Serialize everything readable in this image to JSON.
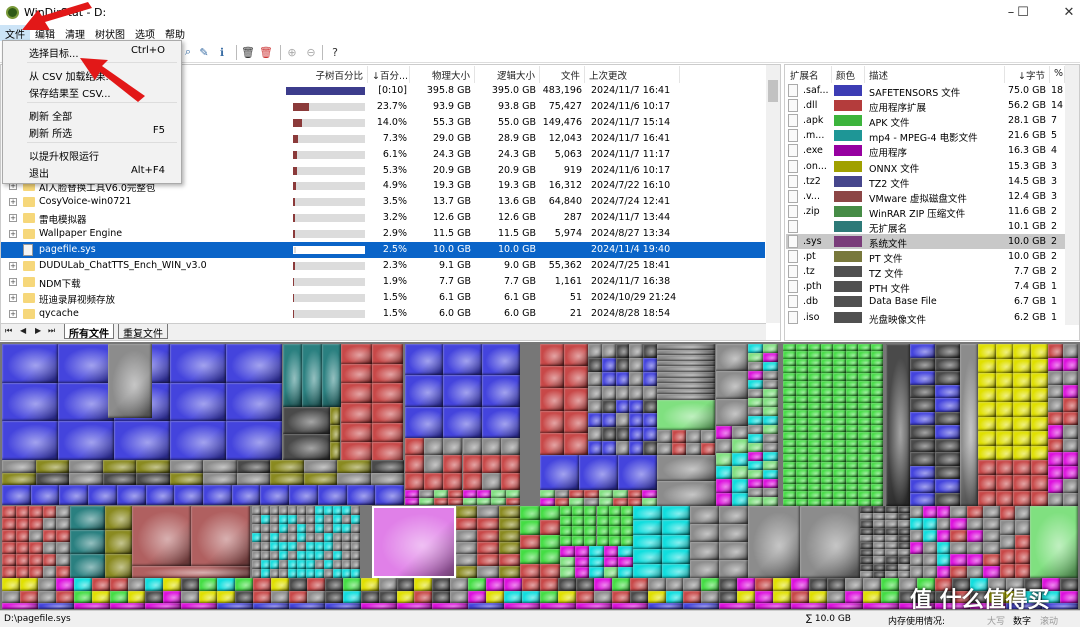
{
  "window": {
    "title": "WinDirStat - D:",
    "minimize": "–",
    "maximize": "☐",
    "close": "✕"
  },
  "menubar": [
    "文件",
    "编辑",
    "清理",
    "树状图",
    "选项",
    "帮助"
  ],
  "file_menu": [
    {
      "label": "选择目标...",
      "shortcut": "Ctrl+O"
    },
    {
      "label": "从 CSV 加载结果...",
      "shortcut": ""
    },
    {
      "label": "保存结果至 CSV...",
      "shortcut": ""
    },
    {
      "label": "刷新 全部",
      "shortcut": ""
    },
    {
      "label": "刷新 所选",
      "shortcut": "F5"
    },
    {
      "label": "以提升权限运行",
      "shortcut": ""
    },
    {
      "label": "退出",
      "shortcut": "Alt+F4"
    }
  ],
  "toolbar": {
    "icons": [
      "search-icon",
      "edit-icon",
      "info-icon",
      "delete-icon",
      "delete-red-icon",
      "zoom-in-icon",
      "zoom-out-icon",
      "help-icon"
    ],
    "help": "?"
  },
  "tree": {
    "columns": [
      "子树百分比",
      "↓百分...",
      "物理大小",
      "逻辑大小",
      "文件",
      "上次更改"
    ],
    "rows": [
      {
        "name": "",
        "pct": "[0:10]",
        "bar": 100,
        "phys": "395.8 GB",
        "logic": "395.0 GB",
        "files": "483,196",
        "date": "2024/11/7  16:41",
        "type": "root"
      },
      {
        "name": "",
        "pct": "23.7%",
        "bar": 23.7,
        "phys": "93.9 GB",
        "logic": "93.8 GB",
        "files": "75,427",
        "date": "2024/11/6  10:17",
        "type": "folder"
      },
      {
        "name": "",
        "pct": "14.0%",
        "bar": 14.0,
        "phys": "55.3 GB",
        "logic": "55.0 GB",
        "files": "149,476",
        "date": "2024/11/7  15:14",
        "type": "folder"
      },
      {
        "name": "",
        "pct": "7.3%",
        "bar": 7.3,
        "phys": "29.0 GB",
        "logic": "28.9 GB",
        "files": "12,043",
        "date": "2024/11/7  16:41",
        "type": "folder"
      },
      {
        "name": "",
        "pct": "6.1%",
        "bar": 6.1,
        "phys": "24.3 GB",
        "logic": "24.3 GB",
        "files": "5,063",
        "date": "2024/11/7  11:17",
        "type": "folder"
      },
      {
        "name": "",
        "pct": "5.3%",
        "bar": 5.3,
        "phys": "20.9 GB",
        "logic": "20.9 GB",
        "files": "919",
        "date": "2024/11/6  10:17",
        "type": "folder"
      },
      {
        "name": "AI人脸替换工具V6.0完整包",
        "pct": "4.9%",
        "bar": 4.9,
        "phys": "19.3 GB",
        "logic": "19.3 GB",
        "files": "16,312",
        "date": "2024/7/22  16:10",
        "type": "folder"
      },
      {
        "name": "CosyVoice-win0721",
        "pct": "3.5%",
        "bar": 3.5,
        "phys": "13.7 GB",
        "logic": "13.6 GB",
        "files": "64,840",
        "date": "2024/7/24  12:41",
        "type": "folder"
      },
      {
        "name": "雷电模拟器",
        "pct": "3.2%",
        "bar": 3.2,
        "phys": "12.6 GB",
        "logic": "12.6 GB",
        "files": "287",
        "date": "2024/11/7  13:44",
        "type": "folder"
      },
      {
        "name": "Wallpaper Engine",
        "pct": "2.9%",
        "bar": 2.9,
        "phys": "11.5 GB",
        "logic": "11.5 GB",
        "files": "5,974",
        "date": "2024/8/27  13:34",
        "type": "folder"
      },
      {
        "name": "pagefile.sys",
        "pct": "2.5%",
        "bar": 2.5,
        "phys": "10.0 GB",
        "logic": "10.0 GB",
        "files": "",
        "date": "2024/11/4  19:40",
        "type": "file",
        "selected": true
      },
      {
        "name": "DUDULab_ChatTTS_Ench_WIN_v3.0",
        "pct": "2.3%",
        "bar": 2.3,
        "phys": "9.1 GB",
        "logic": "9.0 GB",
        "files": "55,362",
        "date": "2024/7/25  18:41",
        "type": "folder"
      },
      {
        "name": "NDM下载",
        "pct": "1.9%",
        "bar": 1.9,
        "phys": "7.7 GB",
        "logic": "7.7 GB",
        "files": "1,161",
        "date": "2024/11/7  16:38",
        "type": "folder"
      },
      {
        "name": "班迪录屏视频存放",
        "pct": "1.5%",
        "bar": 1.5,
        "phys": "6.1 GB",
        "logic": "6.1 GB",
        "files": "51",
        "date": "2024/10/29  21:24",
        "type": "folder"
      },
      {
        "name": "qycache",
        "pct": "1.5%",
        "bar": 1.5,
        "phys": "6.0 GB",
        "logic": "6.0 GB",
        "files": "21",
        "date": "2024/8/28  18:54",
        "type": "folder"
      }
    ]
  },
  "tabs": {
    "nav": [
      "⏮",
      "◀",
      "▶",
      "⏭"
    ],
    "items": [
      "所有文件",
      "重复文件"
    ],
    "active": 0
  },
  "extensions": {
    "columns": [
      "扩展名",
      "颜色",
      "描述",
      "↓字节",
      "%"
    ],
    "rows": [
      {
        "ext": ".saf...",
        "color": "#3c3cb4",
        "desc": "SAFETENSORS 文件",
        "bytes": "75.0 GB",
        "pct": "18"
      },
      {
        "ext": ".dll",
        "color": "#b43c3c",
        "desc": "应用程序扩展",
        "bytes": "56.2 GB",
        "pct": "14"
      },
      {
        "ext": ".apk",
        "color": "#3cb43c",
        "desc": "APK 文件",
        "bytes": "28.1 GB",
        "pct": "7"
      },
      {
        "ext": ".m...",
        "color": "#1e9696",
        "desc": "mp4 - MPEG-4 电影文件",
        "bytes": "21.6 GB",
        "pct": "5"
      },
      {
        "ext": ".exe",
        "color": "#9600a0",
        "desc": "应用程序",
        "bytes": "16.3 GB",
        "pct": "4"
      },
      {
        "ext": ".on...",
        "color": "#a0a000",
        "desc": "ONNX 文件",
        "bytes": "15.3 GB",
        "pct": "3"
      },
      {
        "ext": ".tz2",
        "color": "#46468c",
        "desc": "TZ2 文件",
        "bytes": "14.5 GB",
        "pct": "3"
      },
      {
        "ext": ".v...",
        "color": "#8c4646",
        "desc": "VMware 虚拟磁盘文件",
        "bytes": "12.4 GB",
        "pct": "3"
      },
      {
        "ext": ".zip",
        "color": "#468c46",
        "desc": "WinRAR ZIP 压缩文件",
        "bytes": "11.6 GB",
        "pct": "2"
      },
      {
        "ext": "",
        "color": "#2e7a78",
        "desc": "无扩展名",
        "bytes": "10.1 GB",
        "pct": "2"
      },
      {
        "ext": ".sys",
        "color": "#7a3c7a",
        "desc": "系统文件",
        "bytes": "10.0 GB",
        "pct": "2",
        "selected": true
      },
      {
        "ext": ".pt",
        "color": "#78783c",
        "desc": "PT 文件",
        "bytes": "10.0 GB",
        "pct": "2"
      },
      {
        "ext": ".tz",
        "color": "#505050",
        "desc": "TZ 文件",
        "bytes": "7.7 GB",
        "pct": "2"
      },
      {
        "ext": ".pth",
        "color": "#505050",
        "desc": "PTH 文件",
        "bytes": "7.4 GB",
        "pct": "1"
      },
      {
        "ext": ".db",
        "color": "#505050",
        "desc": "Data Base File",
        "bytes": "6.7 GB",
        "pct": "1"
      },
      {
        "ext": ".iso",
        "color": "#505050",
        "desc": "光盘映像文件",
        "bytes": "6.2 GB",
        "pct": "1"
      }
    ]
  },
  "status": {
    "path": "D:\\pagefile.sys",
    "total": "∑ 10.0 GB",
    "memory": "内存使用情况:",
    "caps": "大写",
    "num": "数字",
    "scroll": "滚动"
  },
  "watermark": "值 什么值得买"
}
